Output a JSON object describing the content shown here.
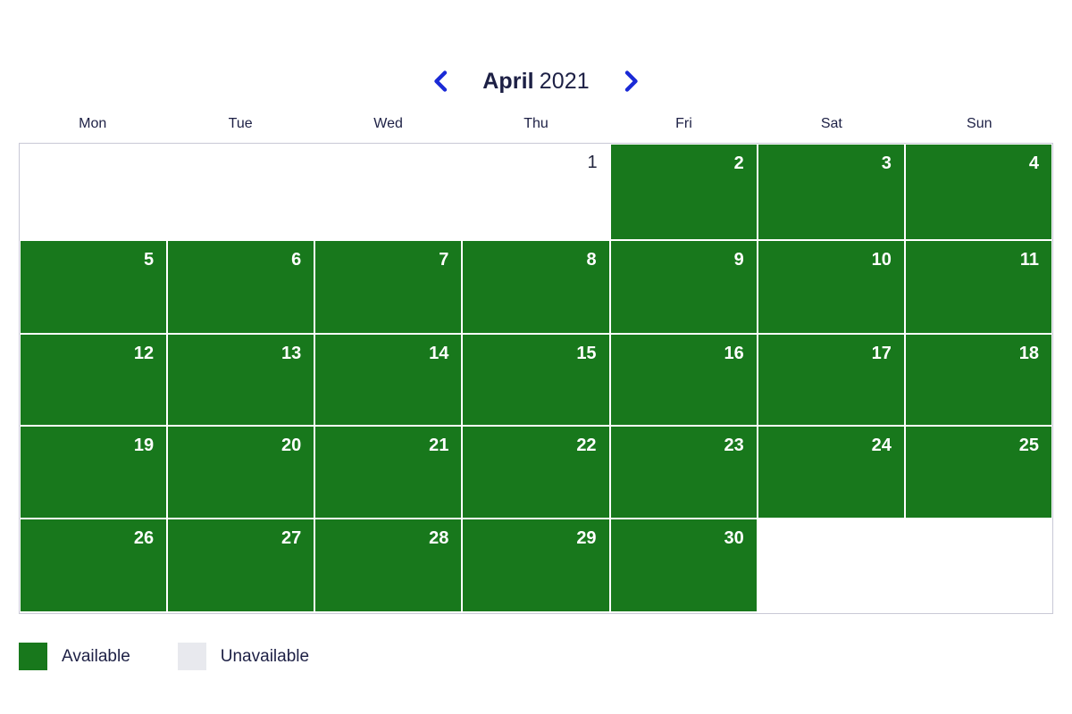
{
  "header": {
    "month_name": "April",
    "year": "2021",
    "prev_icon": "chevron-left-icon",
    "next_icon": "chevron-right-icon",
    "accent_color": "#1a2ad6",
    "title_color": "#1d2045"
  },
  "weekdays": [
    "Mon",
    "Tue",
    "Wed",
    "Thu",
    "Fri",
    "Sat",
    "Sun"
  ],
  "colors": {
    "available": "#18781c",
    "unavailable": "#ffffff",
    "legend_unavailable_swatch": "#e8e9ee",
    "grid_border": "#c9c9d6",
    "day_text_available": "#ffffff",
    "day_text_unavailable": "#23263f"
  },
  "grid": {
    "rows": [
      [
        {
          "day": "",
          "state": "empty"
        },
        {
          "day": "",
          "state": "empty"
        },
        {
          "day": "",
          "state": "empty"
        },
        {
          "day": "1",
          "state": "unavailable"
        },
        {
          "day": "2",
          "state": "available"
        },
        {
          "day": "3",
          "state": "available"
        },
        {
          "day": "4",
          "state": "available"
        }
      ],
      [
        {
          "day": "5",
          "state": "available"
        },
        {
          "day": "6",
          "state": "available"
        },
        {
          "day": "7",
          "state": "available"
        },
        {
          "day": "8",
          "state": "available"
        },
        {
          "day": "9",
          "state": "available"
        },
        {
          "day": "10",
          "state": "available"
        },
        {
          "day": "11",
          "state": "available"
        }
      ],
      [
        {
          "day": "12",
          "state": "available"
        },
        {
          "day": "13",
          "state": "available"
        },
        {
          "day": "14",
          "state": "available"
        },
        {
          "day": "15",
          "state": "available"
        },
        {
          "day": "16",
          "state": "available"
        },
        {
          "day": "17",
          "state": "available"
        },
        {
          "day": "18",
          "state": "available"
        }
      ],
      [
        {
          "day": "19",
          "state": "available"
        },
        {
          "day": "20",
          "state": "available"
        },
        {
          "day": "21",
          "state": "available"
        },
        {
          "day": "22",
          "state": "available"
        },
        {
          "day": "23",
          "state": "available"
        },
        {
          "day": "24",
          "state": "available"
        },
        {
          "day": "25",
          "state": "available"
        }
      ],
      [
        {
          "day": "26",
          "state": "available"
        },
        {
          "day": "27",
          "state": "available"
        },
        {
          "day": "28",
          "state": "available"
        },
        {
          "day": "29",
          "state": "available"
        },
        {
          "day": "30",
          "state": "available"
        },
        {
          "day": "",
          "state": "empty"
        },
        {
          "day": "",
          "state": "empty"
        }
      ]
    ]
  },
  "legend": {
    "items": [
      {
        "label": "Available",
        "state": "available"
      },
      {
        "label": "Unavailable",
        "state": "unavailable"
      }
    ]
  }
}
